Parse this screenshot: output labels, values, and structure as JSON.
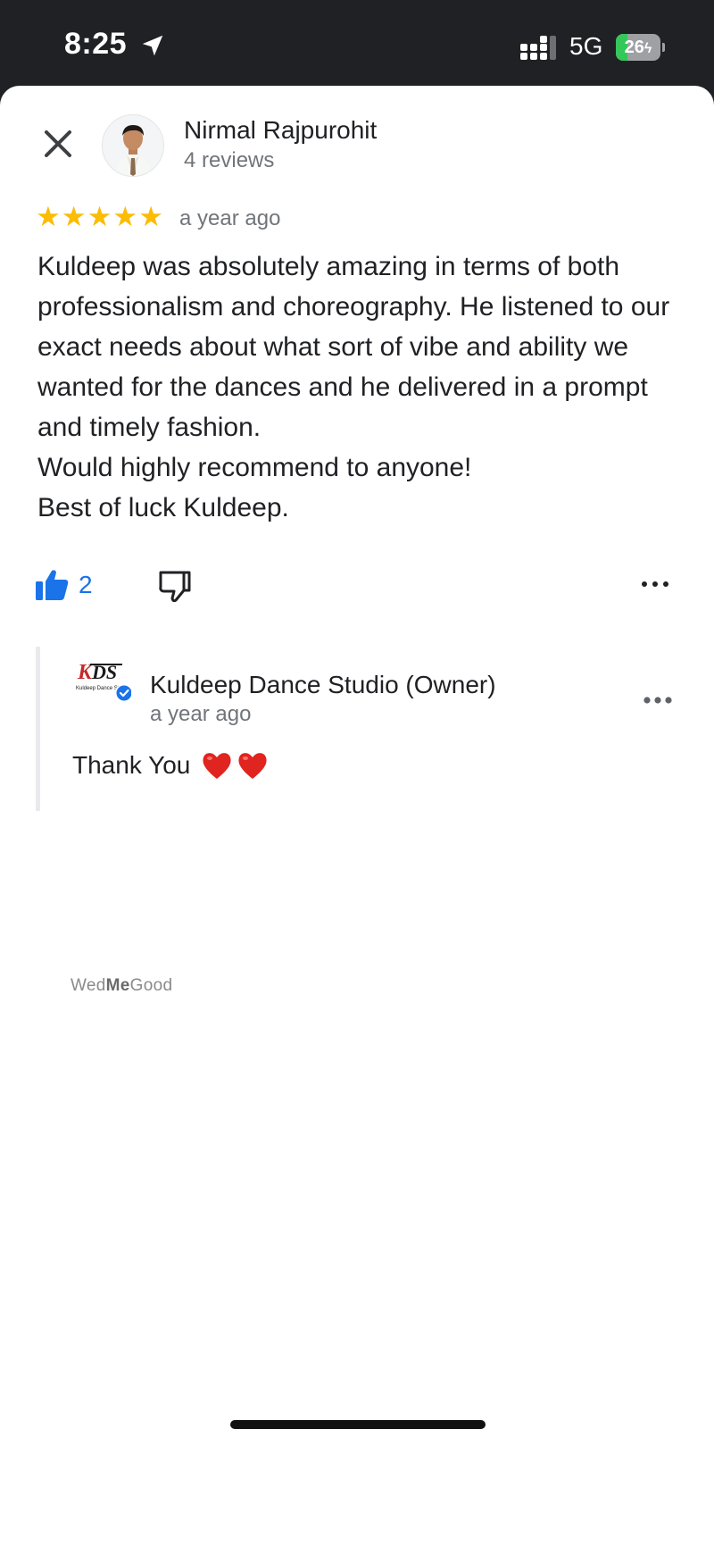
{
  "status_bar": {
    "time": "8:25",
    "network": "5G",
    "battery": "26",
    "battery_level": 0.26,
    "icons": [
      "location-arrow-icon",
      "signal-icon",
      "battery-charging-icon"
    ]
  },
  "review": {
    "close_icon": "close-icon",
    "reviewer_name": "Nirmal Rajpurohit",
    "reviewer_reviews": "4 reviews",
    "rating": 5,
    "rating_max": 5,
    "time": "a year ago",
    "text_lines": [
      "Kuldeep was absolutely amazing in terms of both professionalism and choreography. He listened to our exact needs about what sort of vibe and ability we wanted for the dances and he delivered in a prompt and timely fashion.",
      "Would highly recommend to anyone!",
      "Best of luck Kuldeep."
    ],
    "likes": "2"
  },
  "reply": {
    "owner_name": "Kuldeep Dance Studio (Owner)",
    "logo_text": "KDS",
    "logo_subtext": "Kuldeep Dance Stu",
    "time": "a year ago",
    "text": "Thank You",
    "emoji": [
      "heart",
      "heart"
    ]
  },
  "watermark": {
    "part1": "Wed",
    "part2": "Me",
    "part3": "Good"
  },
  "colors": {
    "accent_blue": "#1a73e8",
    "star_yellow": "#fbbc04",
    "heart_red": "#e0241f",
    "verified_blue": "#1a73e8"
  }
}
